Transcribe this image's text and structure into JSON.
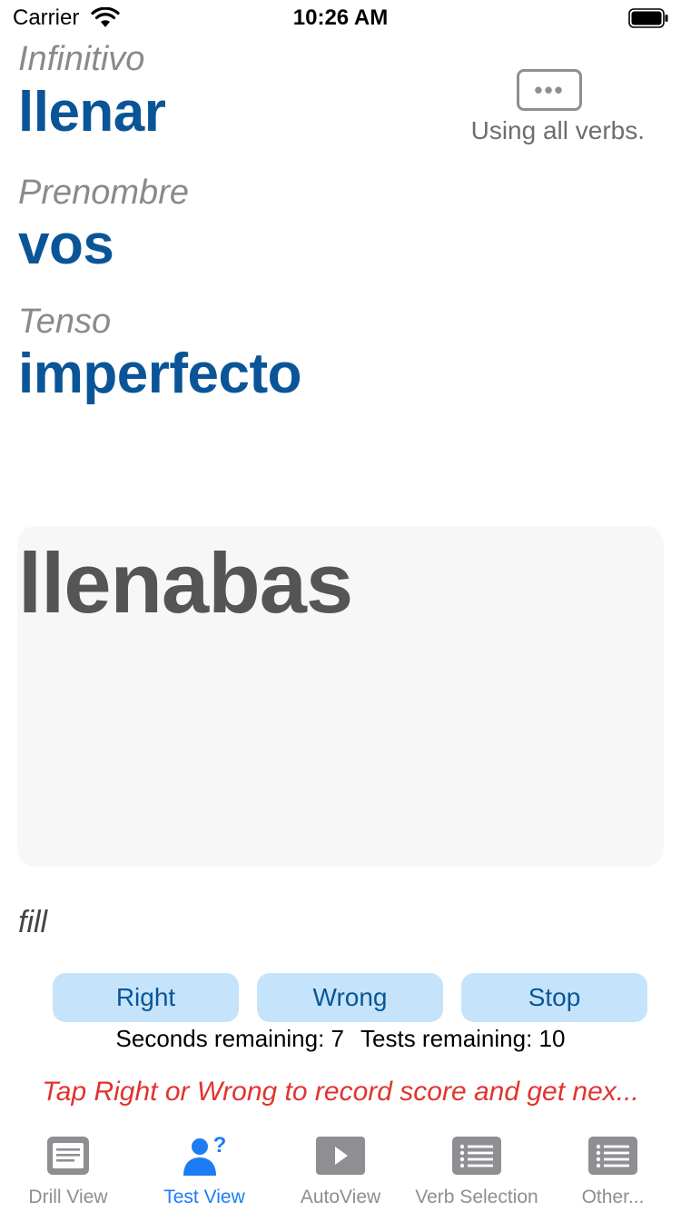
{
  "status": {
    "carrier": "Carrier",
    "time": "10:26 AM"
  },
  "drill": {
    "infinitive_label": "Infinitivo",
    "infinitive_value": "llenar",
    "pronoun_label": "Prenombre",
    "pronoun_value": "vos",
    "tense_label": "Tenso",
    "tense_value": "imperfecto",
    "more_icon": "ellipsis-icon",
    "scope_text": "Using all verbs."
  },
  "answer": {
    "text": "llenabas",
    "meaning": "fill"
  },
  "controls": {
    "right_label": "Right",
    "wrong_label": "Wrong",
    "stop_label": "Stop",
    "seconds_text": "Seconds remaining: 7",
    "tests_text": "Tests remaining: 10",
    "hint": "Tap Right or Wrong to record score and get nex..."
  },
  "tabs": [
    {
      "label": "Drill View",
      "icon": "document-icon",
      "active": false
    },
    {
      "label": "Test View",
      "icon": "person-question-icon",
      "active": true
    },
    {
      "label": "AutoView",
      "icon": "play-icon",
      "active": false
    },
    {
      "label": "Verb Selection",
      "icon": "list-icon",
      "active": false
    },
    {
      "label": "Other...",
      "icon": "list-icon",
      "active": false
    }
  ],
  "colors": {
    "accent": "#0a5597",
    "tab_active": "#1c7cf4",
    "hint": "#e0342f",
    "button_bg": "#c5e4fb"
  }
}
